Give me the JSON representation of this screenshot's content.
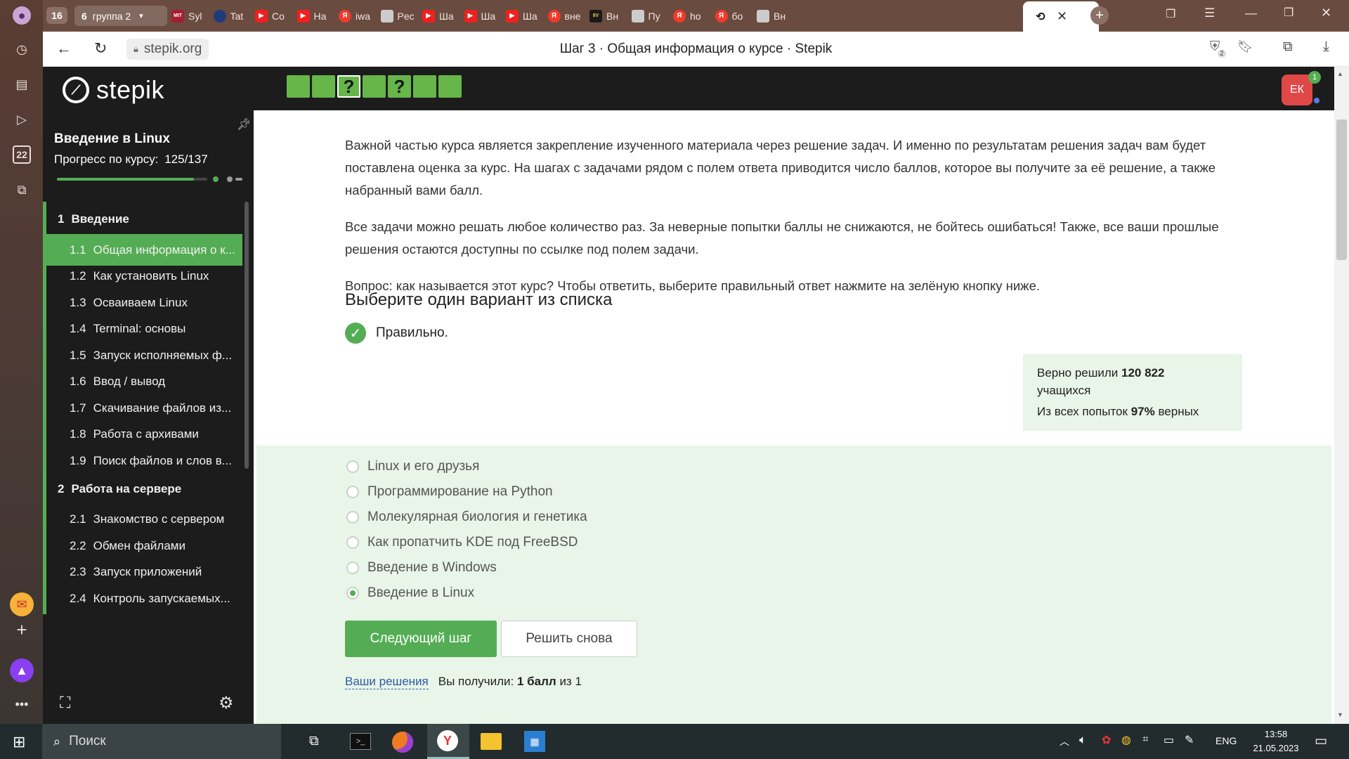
{
  "browser": {
    "tabs": [
      {
        "label": "16",
        "kind": "counter"
      },
      {
        "label": "6",
        "kind": "group-count"
      },
      {
        "label": "группа 2",
        "kind": "group"
      },
      {
        "label": "Syl",
        "icon": "mit"
      },
      {
        "label": "Tat",
        "icon": "dk"
      },
      {
        "label": "Co",
        "icon": "yt"
      },
      {
        "label": "Ha",
        "icon": "yt"
      },
      {
        "label": "iwa",
        "icon": "ya"
      },
      {
        "label": "Pec",
        "icon": "pg"
      },
      {
        "label": "Ша",
        "icon": "yt"
      },
      {
        "label": "Ша",
        "icon": "yt"
      },
      {
        "label": "Ша",
        "icon": "yt"
      },
      {
        "label": "вне",
        "icon": "ya"
      },
      {
        "label": "Вн",
        "icon": "iv"
      },
      {
        "label": "Пу",
        "icon": "pg"
      },
      {
        "label": "ho",
        "icon": "ya"
      },
      {
        "label": "бо",
        "icon": "ya"
      },
      {
        "label": "Вн",
        "icon": "pg"
      }
    ],
    "url": "stepik.org",
    "page_title": "Шаг 3 · Общая информация о курсе · Stepik",
    "counter_badge": "2",
    "sidebar_date": "22"
  },
  "stepik": {
    "logo": "stepik",
    "avatar": "ЕК",
    "avatar_badge": "1",
    "progress_steps": [
      "",
      "",
      "?",
      "",
      "?",
      "",
      ""
    ],
    "course_title": "Введение в Linux",
    "progress_label": "Прогресс по курсу:",
    "progress_value": "125/137",
    "progress_fraction": 0.912,
    "nav": [
      {
        "type": "section",
        "num": "1",
        "label": "Введение"
      },
      {
        "type": "lesson",
        "num": "1.1",
        "label": "Общая информация о к...",
        "active": true
      },
      {
        "type": "lesson",
        "num": "1.2",
        "label": "Как установить Linux"
      },
      {
        "type": "lesson",
        "num": "1.3",
        "label": "Осваиваем Linux"
      },
      {
        "type": "lesson",
        "num": "1.4",
        "label": "Terminal: основы"
      },
      {
        "type": "lesson",
        "num": "1.5",
        "label": "Запуск исполняемых ф..."
      },
      {
        "type": "lesson",
        "num": "1.6",
        "label": "Ввод / вывод"
      },
      {
        "type": "lesson",
        "num": "1.7",
        "label": "Скачивание файлов из..."
      },
      {
        "type": "lesson",
        "num": "1.8",
        "label": "Работа с архивами"
      },
      {
        "type": "lesson",
        "num": "1.9",
        "label": "Поиск файлов и слов в..."
      },
      {
        "type": "section",
        "num": "2",
        "label": "Работа на сервере"
      },
      {
        "type": "lesson",
        "num": "2.1",
        "label": "Знакомство с сервером"
      },
      {
        "type": "lesson",
        "num": "2.2",
        "label": "Обмен файлами"
      },
      {
        "type": "lesson",
        "num": "2.3",
        "label": "Запуск приложений"
      },
      {
        "type": "lesson",
        "num": "2.4",
        "label": "Контроль запускаемых..."
      }
    ],
    "paragraphs": [
      "Важной частью курса является закрепление изученного материала через решение задач. И именно по результатам решения задач вам будет поставлена оценка за курс. На шагах с задачами рядом с полем ответа приводится число баллов, которое вы получите за её решение, а также набранный вами балл.",
      "Все задачи можно решать любое количество раз. За неверные попытки баллы не снижаются, не бойтесь ошибаться! Также, все ваши прошлые решения остаются доступны по ссылке под полем задачи.",
      "Вопрос: как называется этот курс? Чтобы ответить, выберите правильный ответ нажмите на зелёную кнопку ниже."
    ],
    "quiz_title": "Выберите один вариант из списка",
    "correct_text": "Правильно.",
    "stats": {
      "solved_prefix": "Верно решили",
      "solved_count": "120 822",
      "solved_suffix": "учащихся",
      "attempts_prefix": "Из всех попыток",
      "attempts_pct": "97%",
      "attempts_suffix": "верных"
    },
    "options": [
      {
        "label": "Linux и его друзья",
        "selected": false
      },
      {
        "label": "Программирование на Python",
        "selected": false
      },
      {
        "label": "Молекулярная биология и генетика",
        "selected": false
      },
      {
        "label": "Как пропатчить KDE под FreeBSD",
        "selected": false
      },
      {
        "label": "Введение в Windows",
        "selected": false
      },
      {
        "label": "Введение в Linux",
        "selected": true
      }
    ],
    "next_button": "Следующий шаг",
    "retry_button": "Решить снова",
    "solutions_link": "Ваши решения",
    "score_prefix": "Вы получили:",
    "score_bold": "1 балл",
    "score_suffix": "из 1"
  },
  "taskbar": {
    "search_placeholder": "Поиск",
    "lang": "ENG",
    "time": "13:58",
    "date": "21.05.2023"
  },
  "colors": {
    "accent_green": "#54ad54",
    "progress_green": "#66b64a",
    "stepik_dark": "#1c1c1c",
    "correct_bg": "#e8f5e8",
    "avatar_red": "#e04848"
  }
}
